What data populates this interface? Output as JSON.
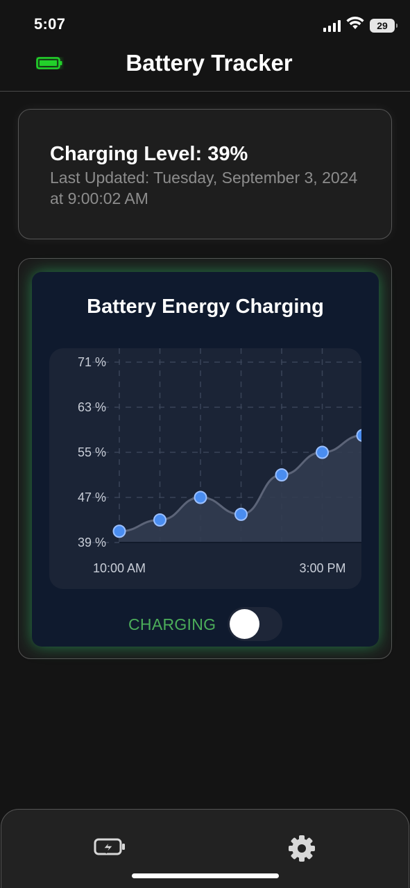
{
  "status_bar": {
    "time": "5:07",
    "battery_level": "29",
    "icons": [
      "signal-icon",
      "wifi-icon",
      "battery-icon"
    ]
  },
  "header": {
    "title": "Battery Tracker",
    "icon": "battery-full-icon",
    "icon_color": "#22d12a"
  },
  "level_card": {
    "level_text": "Charging Level: 39%",
    "updated_text": "Last Updated: Tuesday, September 3, 2024 at 9:00:02 AM"
  },
  "chart_card": {
    "title": "Battery Energy Charging",
    "toggle_label": "CHARGING",
    "toggle_on": false,
    "accent_color": "#4cae5a",
    "glow_color": "#2ec86e",
    "point_color": "#4a8df0"
  },
  "chart_data": {
    "type": "area",
    "title": "Battery Energy Charging",
    "xlabel": "",
    "ylabel": "",
    "x_tick_labels": [
      "10:00 AM",
      "3:00 PM"
    ],
    "y_tick_labels": [
      "71 %",
      "63 %",
      "55 %",
      "47 %",
      "39 %"
    ],
    "ylim": [
      39,
      71
    ],
    "series": [
      {
        "values": [
          41,
          43,
          47,
          44,
          51,
          55,
          58
        ]
      }
    ],
    "grid": true,
    "legend": "none"
  },
  "tab_bar": {
    "items": [
      {
        "icon": "battery-charging-icon"
      },
      {
        "icon": "gear-icon"
      }
    ]
  }
}
